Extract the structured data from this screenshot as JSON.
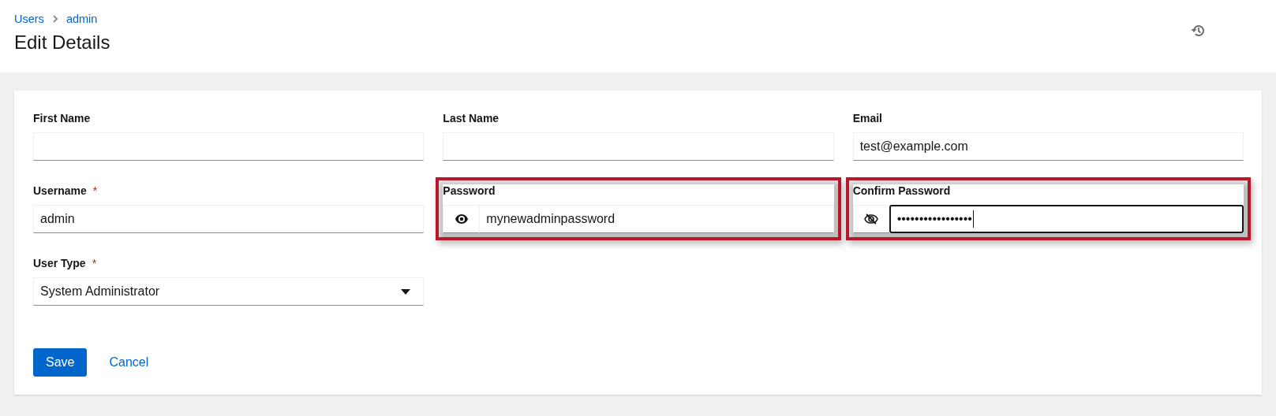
{
  "breadcrumb": [
    {
      "label": "Users"
    },
    {
      "label": "admin"
    }
  ],
  "title": "Edit Details",
  "fields": [
    {
      "kind": "text",
      "label": "First Name",
      "highlighted": false,
      "focused": false
    },
    {
      "kind": "text",
      "label": "Last Name",
      "highlighted": false,
      "focused": false
    },
    {
      "kind": "text",
      "label": "Email",
      "value": "test@example.com",
      "highlighted": false,
      "focused": false
    },
    {
      "kind": "text",
      "label": "Username",
      "required_mark": "*",
      "value": "admin",
      "highlighted": false,
      "focused": false
    },
    {
      "kind": "password",
      "label": "Password",
      "value": "mynewadminpassword",
      "revealed": true,
      "highlighted": true,
      "focused": false
    },
    {
      "kind": "password",
      "label": "Confirm Password",
      "value": "•••••••••••••••••",
      "revealed": false,
      "highlighted": true,
      "focused": true
    },
    {
      "kind": "select",
      "label": "User Type",
      "required_mark": "*",
      "value": "System Administrator",
      "highlighted": false,
      "focused": false
    }
  ],
  "buttons": [
    {
      "kind": "primary",
      "label": "Save"
    },
    {
      "kind": "link",
      "label": "Cancel"
    }
  ]
}
